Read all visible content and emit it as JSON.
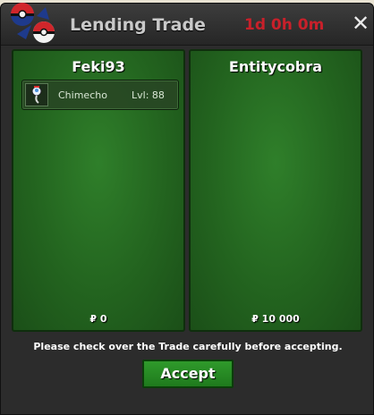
{
  "window": {
    "title": "Lending Trade",
    "timer": "1d 0h 0m",
    "close_symbol": "✕",
    "logo_icon": "pokeball-swap-icon"
  },
  "trade": {
    "left": {
      "player": "Feki93",
      "items": [
        {
          "name": "Chimecho",
          "level": "Lvl: 88",
          "icon": "chimecho-sprite-icon"
        }
      ],
      "money": "₽ 0"
    },
    "right": {
      "player": "Entitycobra",
      "items": [],
      "money": "₽ 10 000"
    }
  },
  "notice": "Please check over the Trade carefully before accepting.",
  "accept_label": "Accept",
  "colors": {
    "panel_green": "#23641f",
    "timer_red": "#c8202a",
    "accept_green": "#2f9a2b"
  }
}
